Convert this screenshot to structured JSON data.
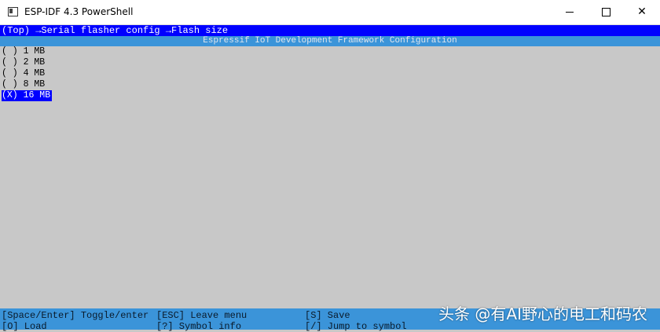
{
  "window": {
    "title": "ESP-IDF 4.3 PowerShell"
  },
  "breadcrumb": "(Top) →Serial flasher config →Flash size",
  "header": "Espressif IoT Development Framework Configuration",
  "options": [
    {
      "label": "( ) 1 MB",
      "selected": false
    },
    {
      "label": "( ) 2 MB",
      "selected": false
    },
    {
      "label": "( ) 4 MB",
      "selected": false
    },
    {
      "label": "( ) 8 MB",
      "selected": false
    },
    {
      "label": "(X) 16 MB",
      "selected": true
    }
  ],
  "help": {
    "space_enter": "[Space/Enter] Toggle/enter",
    "esc": "[ESC] Leave menu",
    "save": "[S] Save",
    "load": "[O] Load",
    "symbol_info": "[?] Symbol info",
    "jump": "[/] Jump to symbol"
  },
  "watermark": "头条 @有AI野心的电工和码农",
  "colors": {
    "terminal_bg": "#c8c8c8",
    "highlight": "#0000ff",
    "bar": "#3b94d9"
  }
}
